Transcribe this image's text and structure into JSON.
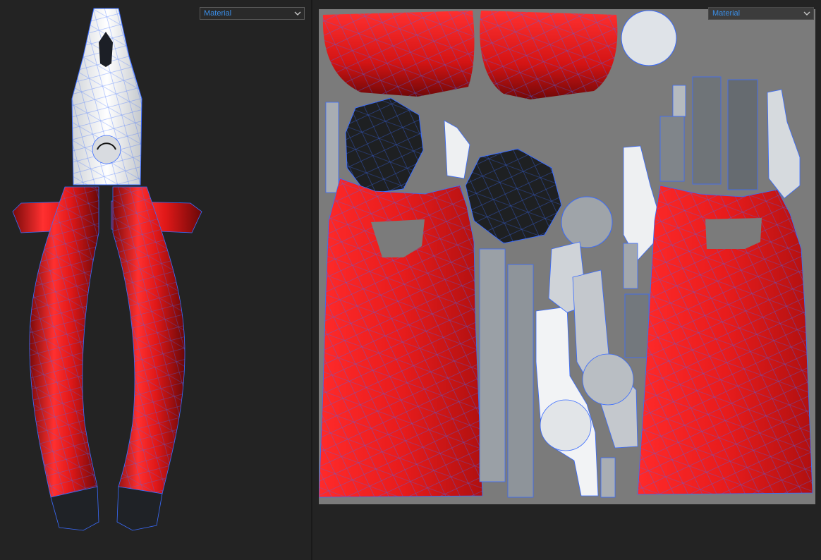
{
  "left_panel": {
    "material_dropdown": {
      "selected": "Material"
    }
  },
  "right_panel": {
    "material_dropdown": {
      "selected": "Material"
    }
  },
  "colors": {
    "background": "#232323",
    "uv_background": "#7b7b7b",
    "handle_red": "#e01818",
    "wire_blue": "#3a6cff",
    "metal": "#e8eaec",
    "dropdown_text": "#3b8fe8"
  },
  "icons": [
    "chevron-down-icon"
  ]
}
